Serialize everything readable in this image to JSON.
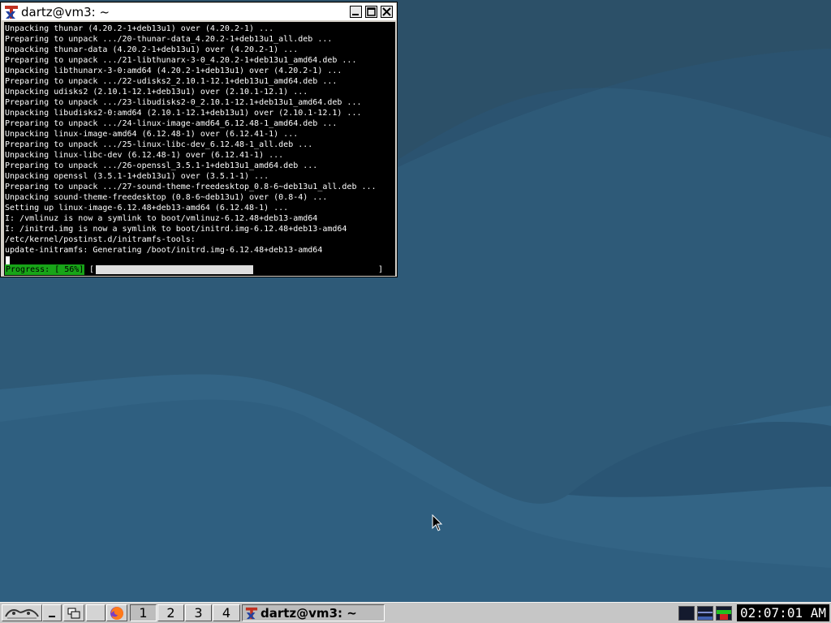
{
  "colors": {
    "desktop_base": "#2c5068",
    "wave_light": "#336485",
    "wave_mid": "#2a5574",
    "terminal_bg": "#000000",
    "terminal_fg": "#ffffff",
    "progress_green": "#18a418",
    "taskbar_bg": "#c6c6c6",
    "clock_bg": "#000000"
  },
  "terminal_window": {
    "title": "dartz@vm3: ~",
    "title_icon": "xterm-icon",
    "buttons": [
      "minimize-icon",
      "maximize-icon",
      "close-icon"
    ],
    "lines": [
      "Unpacking thunar (4.20.2-1+deb13u1) over (4.20.2-1) ...",
      "Preparing to unpack .../20-thunar-data_4.20.2-1+deb13u1_all.deb ...",
      "Unpacking thunar-data (4.20.2-1+deb13u1) over (4.20.2-1) ...",
      "Preparing to unpack .../21-libthunarx-3-0_4.20.2-1+deb13u1_amd64.deb ...",
      "Unpacking libthunarx-3-0:amd64 (4.20.2-1+deb13u1) over (4.20.2-1) ...",
      "Preparing to unpack .../22-udisks2_2.10.1-12.1+deb13u1_amd64.deb ...",
      "Unpacking udisks2 (2.10.1-12.1+deb13u1) over (2.10.1-12.1) ...",
      "Preparing to unpack .../23-libudisks2-0_2.10.1-12.1+deb13u1_amd64.deb ...",
      "Unpacking libudisks2-0:amd64 (2.10.1-12.1+deb13u1) over (2.10.1-12.1) ...",
      "Preparing to unpack .../24-linux-image-amd64_6.12.48-1_amd64.deb ...",
      "Unpacking linux-image-amd64 (6.12.48-1) over (6.12.41-1) ...",
      "Preparing to unpack .../25-linux-libc-dev_6.12.48-1_all.deb ...",
      "Unpacking linux-libc-dev (6.12.48-1) over (6.12.41-1) ...",
      "Preparing to unpack .../26-openssl_3.5.1-1+deb13u1_amd64.deb ...",
      "Unpacking openssl (3.5.1-1+deb13u1) over (3.5.1-1) ...",
      "Preparing to unpack .../27-sound-theme-freedesktop_0.8-6~deb13u1_all.deb ...",
      "Unpacking sound-theme-freedesktop (0.8-6~deb13u1) over (0.8-4) ...",
      "Setting up linux-image-6.12.48+deb13-amd64 (6.12.48-1) ...",
      "I: /vmlinuz is now a symlink to boot/vmlinuz-6.12.48+deb13-amd64",
      "I: /initrd.img is now a symlink to boot/initrd.img-6.12.48+deb13-amd64",
      "/etc/kernel/postinst.d/initramfs-tools:",
      "update-initramfs: Generating /boot/initrd.img-6.12.48+deb13-amd64"
    ],
    "progress": {
      "label": "Progress: [ 56%]",
      "percent": 56,
      "open_bracket": "[",
      "close_bracket": "]"
    }
  },
  "taskbar": {
    "start_icon": "icewm-logo-icon",
    "show_desktop_icon": "minimize-windows-icon",
    "window_list_icon": "window-list-icon",
    "browser_icon": "firefox-icon",
    "workspaces": [
      "1",
      "2",
      "3",
      "4"
    ],
    "active_workspace": "1",
    "task_title": "dartz@vm3: ~",
    "task_icon": "xterm-icon",
    "tray_icons": [
      "cpu-monitor-icon",
      "memory-monitor-icon",
      "network-monitor-icon"
    ],
    "clock": "02:07:01 AM"
  },
  "pointer_icon": "mouse-pointer-icon"
}
